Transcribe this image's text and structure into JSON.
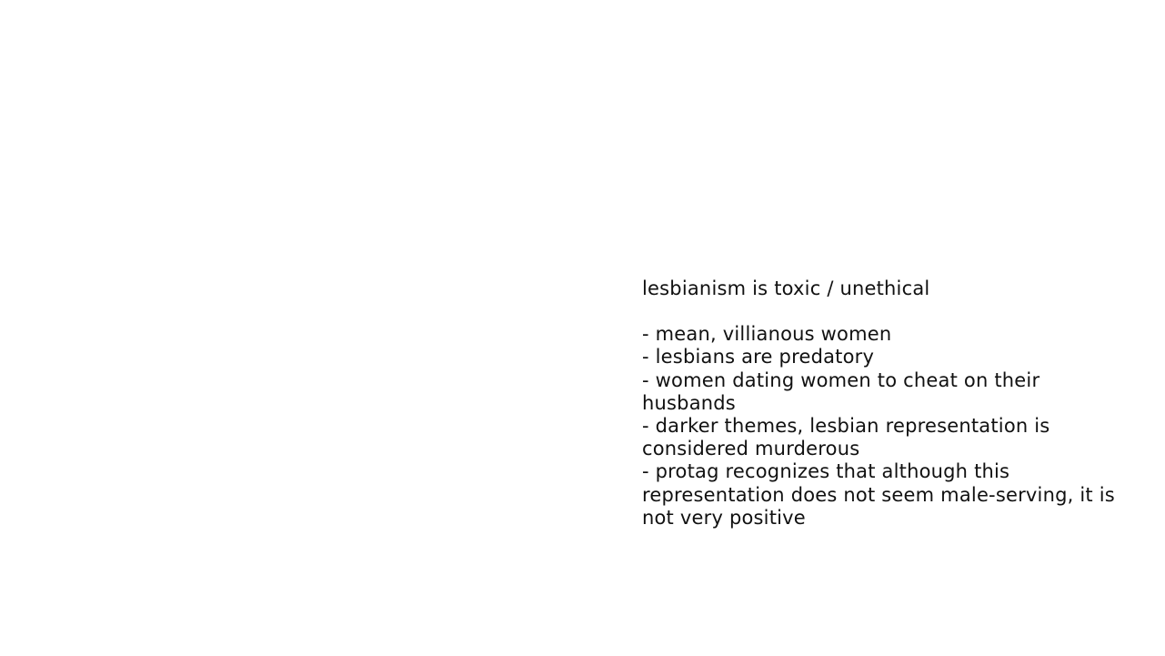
{
  "slide": {
    "title": "lesbianism is toxic / unethical",
    "points": [
      "- mean, villianous women",
      "- lesbians are predatory",
      "- women dating women to cheat on their husbands",
      "- darker themes, lesbian representation is considered murderous",
      "- protag recognizes that although this representation does not seem male-serving, it is not very positive"
    ]
  },
  "colors": {
    "background": "#ffffff",
    "text": "#111111"
  }
}
